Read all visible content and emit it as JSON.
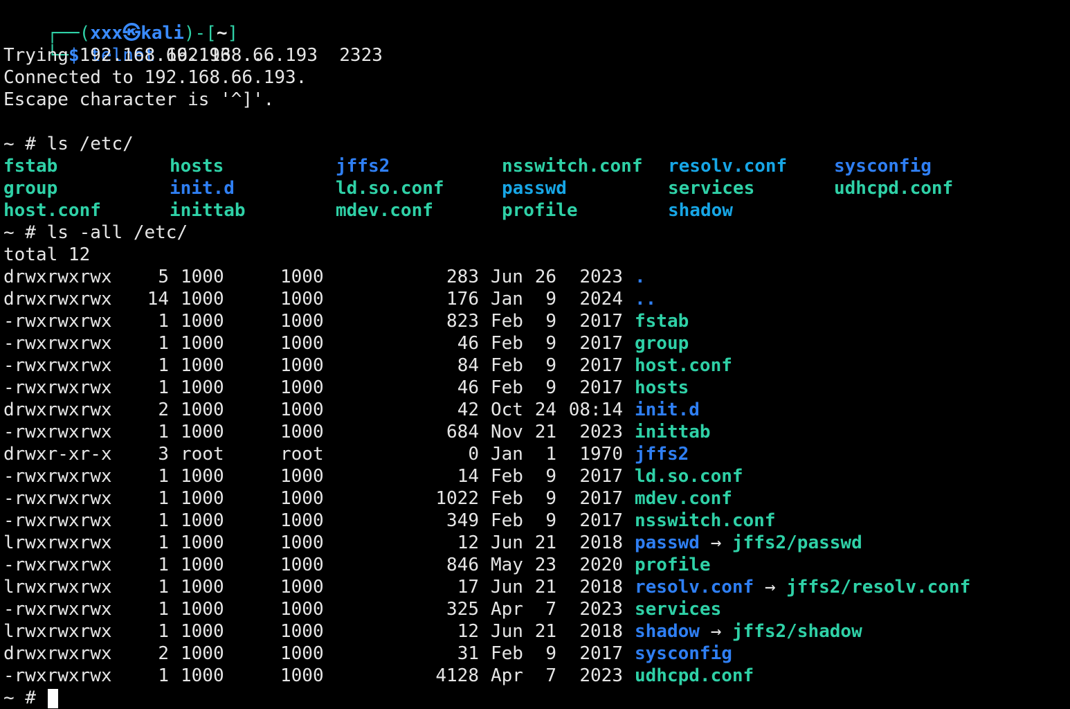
{
  "prompt": {
    "line1_frame_open": "┌──(",
    "user": "xxx",
    "skull": "㉿",
    "host": "kali",
    "line1_frame_mid": ")-[",
    "cwd": "~",
    "line1_frame_close": "]",
    "line2_frame": "└─",
    "dollar": "$",
    "command": "telnet",
    "args": " 192.168.66.193  2323"
  },
  "telnet_output": [
    "Trying 192.168.66.193 ...",
    "Connected to 192.168.66.193.",
    "Escape character is '^]'."
  ],
  "ls_cmd": "~ # ls /etc/",
  "ls_grid": [
    [
      {
        "name": "fstab",
        "kind": "exec"
      },
      {
        "name": "hosts",
        "kind": "exec"
      },
      {
        "name": "jffs2",
        "kind": "dir"
      },
      {
        "name": "nsswitch.conf",
        "kind": "exec"
      },
      {
        "name": "resolv.conf",
        "kind": "link"
      },
      {
        "name": "sysconfig",
        "kind": "dir"
      }
    ],
    [
      {
        "name": "group",
        "kind": "exec"
      },
      {
        "name": "init.d",
        "kind": "dir"
      },
      {
        "name": "ld.so.conf",
        "kind": "exec"
      },
      {
        "name": "passwd",
        "kind": "link"
      },
      {
        "name": "services",
        "kind": "exec"
      },
      {
        "name": "udhcpd.conf",
        "kind": "exec"
      }
    ],
    [
      {
        "name": "host.conf",
        "kind": "exec"
      },
      {
        "name": "inittab",
        "kind": "exec"
      },
      {
        "name": "mdev.conf",
        "kind": "exec"
      },
      {
        "name": "profile",
        "kind": "exec"
      },
      {
        "name": "shadow",
        "kind": "link"
      },
      {
        "name": "",
        "kind": "exec"
      }
    ]
  ],
  "ls_all_cmd": "~ # ls -all /etc/",
  "total_line": "total 12",
  "listing": [
    {
      "perm": "drwxrwxrwx",
      "links": "5",
      "owner": "1000",
      "group": "1000",
      "size": "283",
      "mon": "Jun",
      "day": "26",
      "time": "2023",
      "name": ".",
      "kind": "dir",
      "target": ""
    },
    {
      "perm": "drwxrwxrwx",
      "links": "14",
      "owner": "1000",
      "group": "1000",
      "size": "176",
      "mon": "Jan",
      "day": "9",
      "time": "2024",
      "name": "..",
      "kind": "dir",
      "target": ""
    },
    {
      "perm": "-rwxrwxrwx",
      "links": "1",
      "owner": "1000",
      "group": "1000",
      "size": "823",
      "mon": "Feb",
      "day": "9",
      "time": "2017",
      "name": "fstab",
      "kind": "exec",
      "target": ""
    },
    {
      "perm": "-rwxrwxrwx",
      "links": "1",
      "owner": "1000",
      "group": "1000",
      "size": "46",
      "mon": "Feb",
      "day": "9",
      "time": "2017",
      "name": "group",
      "kind": "exec",
      "target": ""
    },
    {
      "perm": "-rwxrwxrwx",
      "links": "1",
      "owner": "1000",
      "group": "1000",
      "size": "84",
      "mon": "Feb",
      "day": "9",
      "time": "2017",
      "name": "host.conf",
      "kind": "exec",
      "target": ""
    },
    {
      "perm": "-rwxrwxrwx",
      "links": "1",
      "owner": "1000",
      "group": "1000",
      "size": "46",
      "mon": "Feb",
      "day": "9",
      "time": "2017",
      "name": "hosts",
      "kind": "exec",
      "target": ""
    },
    {
      "perm": "drwxrwxrwx",
      "links": "2",
      "owner": "1000",
      "group": "1000",
      "size": "42",
      "mon": "Oct",
      "day": "24",
      "time": "08:14",
      "name": "init.d",
      "kind": "dir",
      "target": ""
    },
    {
      "perm": "-rwxrwxrwx",
      "links": "1",
      "owner": "1000",
      "group": "1000",
      "size": "684",
      "mon": "Nov",
      "day": "21",
      "time": "2023",
      "name": "inittab",
      "kind": "exec",
      "target": ""
    },
    {
      "perm": "drwxr-xr-x",
      "links": "3",
      "owner": "root",
      "group": "root",
      "size": "0",
      "mon": "Jan",
      "day": "1",
      "time": "1970",
      "name": "jffs2",
      "kind": "dir",
      "target": ""
    },
    {
      "perm": "-rwxrwxrwx",
      "links": "1",
      "owner": "1000",
      "group": "1000",
      "size": "14",
      "mon": "Feb",
      "day": "9",
      "time": "2017",
      "name": "ld.so.conf",
      "kind": "exec",
      "target": ""
    },
    {
      "perm": "-rwxrwxrwx",
      "links": "1",
      "owner": "1000",
      "group": "1000",
      "size": "1022",
      "mon": "Feb",
      "day": "9",
      "time": "2017",
      "name": "mdev.conf",
      "kind": "exec",
      "target": ""
    },
    {
      "perm": "-rwxrwxrwx",
      "links": "1",
      "owner": "1000",
      "group": "1000",
      "size": "349",
      "mon": "Feb",
      "day": "9",
      "time": "2017",
      "name": "nsswitch.conf",
      "kind": "exec",
      "target": ""
    },
    {
      "perm": "lrwxrwxrwx",
      "links": "1",
      "owner": "1000",
      "group": "1000",
      "size": "12",
      "mon": "Jun",
      "day": "21",
      "time": "2018",
      "name": "passwd",
      "kind": "link",
      "target": "jffs2/passwd"
    },
    {
      "perm": "-rwxrwxrwx",
      "links": "1",
      "owner": "1000",
      "group": "1000",
      "size": "846",
      "mon": "May",
      "day": "23",
      "time": "2020",
      "name": "profile",
      "kind": "exec",
      "target": ""
    },
    {
      "perm": "lrwxrwxrwx",
      "links": "1",
      "owner": "1000",
      "group": "1000",
      "size": "17",
      "mon": "Jun",
      "day": "21",
      "time": "2018",
      "name": "resolv.conf",
      "kind": "link",
      "target": "jffs2/resolv.conf"
    },
    {
      "perm": "-rwxrwxrwx",
      "links": "1",
      "owner": "1000",
      "group": "1000",
      "size": "325",
      "mon": "Apr",
      "day": "7",
      "time": "2023",
      "name": "services",
      "kind": "exec",
      "target": ""
    },
    {
      "perm": "lrwxrwxrwx",
      "links": "1",
      "owner": "1000",
      "group": "1000",
      "size": "12",
      "mon": "Jun",
      "day": "21",
      "time": "2018",
      "name": "shadow",
      "kind": "link",
      "target": "jffs2/shadow"
    },
    {
      "perm": "drwxrwxrwx",
      "links": "2",
      "owner": "1000",
      "group": "1000",
      "size": "31",
      "mon": "Feb",
      "day": "9",
      "time": "2017",
      "name": "sysconfig",
      "kind": "dir",
      "target": ""
    },
    {
      "perm": "-rwxrwxrwx",
      "links": "1",
      "owner": "1000",
      "group": "1000",
      "size": "4128",
      "mon": "Apr",
      "day": "7",
      "time": "2023",
      "name": "udhcpd.conf",
      "kind": "exec",
      "target": ""
    }
  ],
  "link_arrow": "→",
  "final_prompt": "~ #",
  "colors": {
    "background": "#000000",
    "text": "#e6e6e6",
    "exec": "#2fd1a7",
    "dir": "#2f7ff3",
    "link": "#17a6e6",
    "prompt_user": "#3a8bff"
  }
}
